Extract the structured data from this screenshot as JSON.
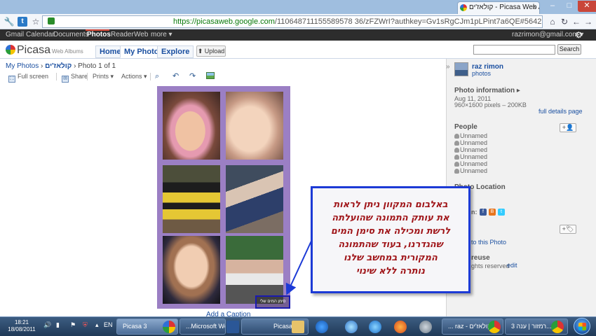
{
  "browser": {
    "tab_title": "קולאז'ים - Picasa Web Albums",
    "tab_close": "×",
    "win_min": "–",
    "win_max": "□",
    "win_close": "✕",
    "url_host": "https://picasaweb.google.com",
    "url_rest": "/110648711155589578 36/zFZWrI?authkey=Gv1sRgCJm1pLPint7a6QE#5642215666572438962",
    "icons": [
      "wrench-icon",
      "twitter-icon",
      "star-icon",
      "house-icon",
      "reload-icon",
      "back-icon",
      "forward-icon"
    ]
  },
  "google_bar": {
    "items": [
      "Gmail",
      "Calendar",
      "Documents",
      "Photos",
      "Reader",
      "Web",
      "more ▾"
    ],
    "active": "Photos",
    "account": "razrimon@gmail.com ▾",
    "settings_icon": "gear-icon"
  },
  "picasa": {
    "logo": "Picasa",
    "logo_sub": "Web Albums",
    "tabs": [
      "Home",
      "My Photos",
      "Explore"
    ],
    "active_tab": "My Photos",
    "upload_label": "Upload",
    "search_label": "Search",
    "search_value": ""
  },
  "breadcrumb": {
    "root": "My Photos",
    "sep": " › ",
    "album": "קולאז'ים",
    "current": " › Photo 1 of 1"
  },
  "toolbar": {
    "fullscreen": "Full screen",
    "share": "Share",
    "prints": "Prints ▾",
    "actions": "Actions ▾"
  },
  "photo": {
    "watermark": "סימן המים שלי",
    "add_caption": "Add a Caption",
    "border_color": "#9b7fc4"
  },
  "sidebar": {
    "owner_name": "raz rimon",
    "owner_link": "photos",
    "photo_info_title": "Photo information ▸",
    "photo_date": "Aug 11, 2011",
    "photo_dims": "960×1600 pixels – 200KB",
    "full_details": "full details page",
    "people_title": "People",
    "people": [
      "Unnamed",
      "Unnamed",
      "Unnamed",
      "Unnamed",
      "Unnamed",
      "Unnamed"
    ],
    "location_title": "Photo Location",
    "share_label": "n:",
    "add_to_photo": "to this Photo",
    "reuse": "reuse",
    "rights": "ghts reserved",
    "edit": "edit"
  },
  "callout": {
    "lines": [
      "באלבום המקוון ניתן לראות",
      "את עותק התמונה שהועלתה",
      "לרשת ומכילה את סימן המים",
      "שהגדרנו, בעוד שהתמונה",
      "המקורית במחשב שלנו",
      "נותרה ללא שינוי"
    ],
    "border_color": "#1c3ad6",
    "text_color": "#a0161a"
  },
  "taskbar": {
    "time": "18:21",
    "date": "18/08/2011",
    "lang": "EN",
    "buttons": [
      "Picasa 3",
      "...Microsoft Wor",
      "Picasa",
      "... raz - קולאז'ים",
      "רמזור | ענה 3..."
    ],
    "active_button": 0
  }
}
